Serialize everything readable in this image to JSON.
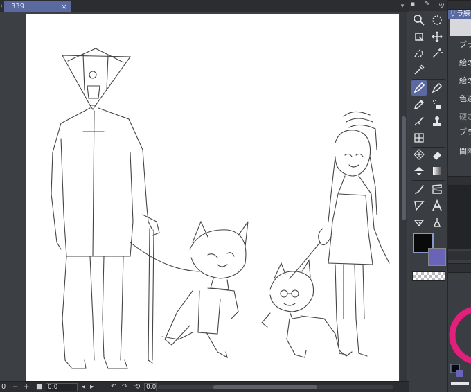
{
  "tab": {
    "title": "339",
    "close": "×"
  },
  "tools_header": {
    "label": "ツ"
  },
  "right_panel": {
    "header": "サラ練",
    "rows": [
      "ブラ",
      "絵の",
      "絵の",
      "色適",
      "硬さ",
      "ブラ",
      "間隔"
    ]
  },
  "status": {
    "zoom_left": "0",
    "minus": "−",
    "plus": "+",
    "value_box": "0.0",
    "angle_box": "0.0"
  },
  "colors": {
    "main": "#0a0a0a",
    "sub": "#6a64b8",
    "accent": "#5a6aa0",
    "canvas": "#ffffff"
  },
  "tool_icons": [
    "magnifier-icon",
    "rotate-icon",
    "object-select-icon",
    "move-icon",
    "lasso-select-icon",
    "magic-wand-icon",
    "eyedropper-icon",
    "pen-icon",
    "pen-alt-icon",
    "pencil-icon",
    "airbrush-icon",
    "brush-icon",
    "stamp-icon",
    "decoration-icon",
    "eraser-icon",
    "blend-icon",
    "fill-icon",
    "gradient-icon",
    "curve-icon",
    "frame-border-icon",
    "figure-icon",
    "text-icon",
    "correct-line-icon",
    "balloon-icon"
  ]
}
